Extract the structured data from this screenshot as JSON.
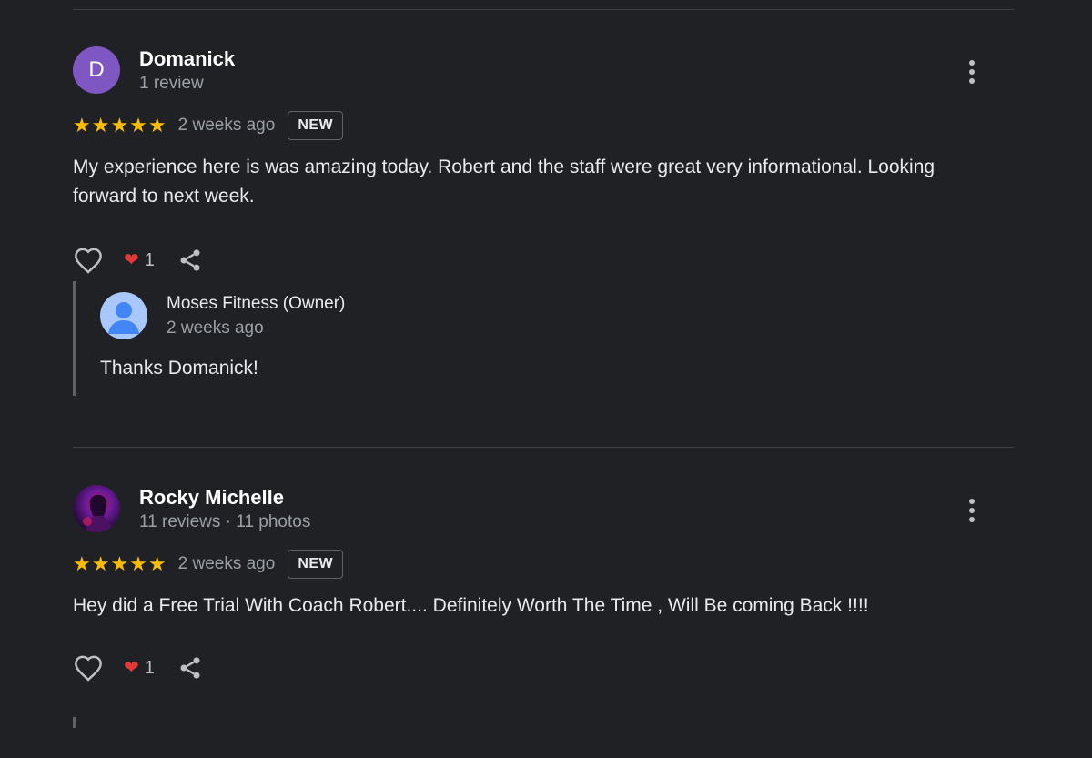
{
  "reviews": [
    {
      "avatar_letter": "D",
      "author": "Domanick",
      "meta": "1 review",
      "stars": "★★★★★",
      "rating": 5,
      "time": "2 weeks ago",
      "badge": "NEW",
      "text": "My experience here is was amazing today. Robert and the staff were great very informational. Looking forward to next week.",
      "reaction_emoji": "❤",
      "reaction_count": "1",
      "owner_reply": {
        "name": "Moses Fitness (Owner)",
        "time": "2 weeks ago",
        "text": "Thanks Domanick!"
      }
    },
    {
      "author": "Rocky Michelle",
      "meta": "11 reviews · 11 photos",
      "stars": "★★★★★",
      "rating": 5,
      "time": "2 weeks ago",
      "badge": "NEW",
      "text": "Hey did a Free Trial With Coach Robert.... Definitely Worth The Time , Will Be coming Back !!!!",
      "reaction_emoji": "❤",
      "reaction_count": "1"
    }
  ],
  "colors": {
    "background": "#202124",
    "star": "#fbbc04",
    "avatar_letter_bg": "#7e57c2",
    "owner_avatar_bg": "#a8c7fa",
    "reaction_heart": "#e53935"
  },
  "icons": {
    "more": "more-vert-icon",
    "like": "heart-outline-icon",
    "share": "share-icon",
    "owner_avatar": "person-icon"
  }
}
